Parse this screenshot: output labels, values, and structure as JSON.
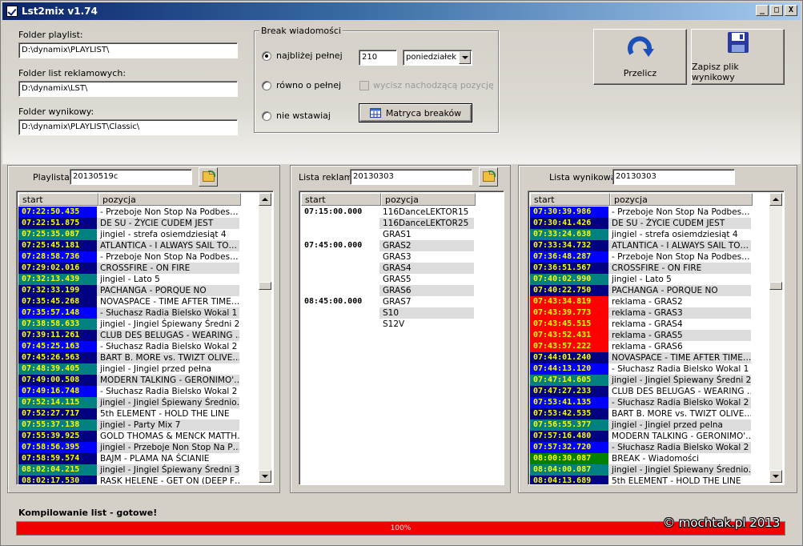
{
  "window": {
    "title": "Lst2mix v1.74",
    "controls": [
      "_",
      "□",
      "X"
    ]
  },
  "folders": {
    "playlist_label": "Folder playlist:",
    "playlist_value": "D:\\dynamix\\PLAYLIST\\",
    "ads_label": "Folder list reklamowych:",
    "ads_value": "D:\\dynamix\\LST\\",
    "output_label": "Folder wynikowy:",
    "output_value": "D:\\dynamix\\PLAYLIST\\Classic\\"
  },
  "break_group": {
    "title": "Break wiadomości",
    "option1": "najbliżej pełnej",
    "option2": "równo o pełnej",
    "option3": "nie wstawiaj",
    "minutes_value": "210",
    "day_value": "poniedziałek",
    "remove_next_label": "wycisz nachodzącą pozycję",
    "matrix_button": "Matryca breaków"
  },
  "actions": {
    "recalc": "Przelicz",
    "save": "Zapisz plik wynikowy"
  },
  "columns": {
    "start": "start",
    "position": "pozycja"
  },
  "playlist": {
    "label": "Playlista:",
    "value": "20130519c",
    "rows": [
      {
        "t": "07:22:50.435",
        "p": " - Przeboje Non Stop Na Podbes…",
        "c": "blue"
      },
      {
        "t": "07:22:51.875",
        "p": "DE SU - ŻYCIE CUDEM JEST",
        "c": "navy"
      },
      {
        "t": "07:25:35.087",
        "p": "jingiel - strefa osiemdziesiąt 4",
        "c": "teal"
      },
      {
        "t": "07:25:45.181",
        "p": "ATLANTICA - I ALWAYS SAIL TO…",
        "c": "navy"
      },
      {
        "t": "07:28:58.736",
        "p": " - Przeboje Non Stop Na Podbes…",
        "c": "blue"
      },
      {
        "t": "07:29:02.016",
        "p": "CROSSFIRE - ON FIRE",
        "c": "navy"
      },
      {
        "t": "07:32:13.439",
        "p": "jingiel - Lato 5",
        "c": "teal"
      },
      {
        "t": "07:32:33.199",
        "p": "PACHANGA - PORQUE NO",
        "c": "navy"
      },
      {
        "t": "07:35:45.268",
        "p": "NOVASPACE - TIME AFTER TIME…",
        "c": "navy"
      },
      {
        "t": "07:35:57.148",
        "p": " - Słuchasz Radia Bielsko Wokal 1",
        "c": "blue"
      },
      {
        "t": "07:38:58.633",
        "p": "jingiel - Jingiel Śpiewany Średni 2",
        "c": "teal"
      },
      {
        "t": "07:39:11.261",
        "p": "CLUB DES BELUGAS - WEARING …",
        "c": "navy"
      },
      {
        "t": "07:45:25.163",
        "p": " - Słuchasz Radia Bielsko Wokal 2",
        "c": "blue"
      },
      {
        "t": "07:45:26.563",
        "p": "BART B. MORE vs. TWIZT OLIVE…",
        "c": "navy"
      },
      {
        "t": "07:48:39.405",
        "p": "jingiel - Jingiel przed pełna",
        "c": "teal"
      },
      {
        "t": "07:49:00.508",
        "p": "MODERN TALKING - GERONIMO'…",
        "c": "navy"
      },
      {
        "t": "07:49:16.748",
        "p": " - Słuchasz Radia Bielsko Wokal 2",
        "c": "blue"
      },
      {
        "t": "07:52:14.115",
        "p": "jingiel - Jingiel Śpiewany Średnio…",
        "c": "teal"
      },
      {
        "t": "07:52:27.717",
        "p": "5th ELEMENT - HOLD THE LINE",
        "c": "navy"
      },
      {
        "t": "07:55:37.138",
        "p": "jingiel - Party Mix 7",
        "c": "teal"
      },
      {
        "t": "07:55:39.925",
        "p": "GOLD THOMAS & MENCK MATTH…",
        "c": "navy"
      },
      {
        "t": "07:58:56.395",
        "p": "jingiel - Przeboje Non Stop Na P…",
        "c": "blue"
      },
      {
        "t": "07:58:59.574",
        "p": "BAJM - PLAMA NA ŚCIANIE",
        "c": "navy"
      },
      {
        "t": "08:02:04.215",
        "p": "jingiel - Jingiel Śpiewany Średni 3",
        "c": "teal"
      },
      {
        "t": "08:02:17.530",
        "p": "RASK HELENE - GET ON (DEEP F…",
        "c": "navy"
      }
    ]
  },
  "ads": {
    "label": "Lista reklam:",
    "value": "20130303",
    "rows": [
      {
        "t": "07:15:00.000",
        "p": "116DanceLEKTOR15"
      },
      {
        "t": "",
        "p": "116DanceLEKTOR25"
      },
      {
        "t": "",
        "p": "GRAS1"
      },
      {
        "t": "07:45:00.000",
        "p": "GRAS2"
      },
      {
        "t": "",
        "p": "GRAS3"
      },
      {
        "t": "",
        "p": "GRAS4"
      },
      {
        "t": "",
        "p": "GRAS5"
      },
      {
        "t": "",
        "p": "GRAS6"
      },
      {
        "t": "08:45:00.000",
        "p": "GRAS7"
      },
      {
        "t": "",
        "p": "S10"
      },
      {
        "t": "",
        "p": "S12V"
      }
    ]
  },
  "output": {
    "label": "Lista wynikowa:",
    "value": "20130303",
    "rows": [
      {
        "t": "07:30:39.986",
        "p": " - Przeboje Non Stop Na Podbes…",
        "c": "blue"
      },
      {
        "t": "07:30:41.426",
        "p": "DE SU - ŻYCIE CUDEM JEST",
        "c": "navy"
      },
      {
        "t": "07:33:24.638",
        "p": "jingiel - strefa osiemdziesiąt 4",
        "c": "teal"
      },
      {
        "t": "07:33:34.732",
        "p": "ATLANTICA - I ALWAYS SAIL TO…",
        "c": "navy"
      },
      {
        "t": "07:36:48.287",
        "p": " - Przeboje Non Stop Na Podbes…",
        "c": "blue"
      },
      {
        "t": "07:36:51.567",
        "p": "CROSSFIRE - ON FIRE",
        "c": "navy"
      },
      {
        "t": "07:40:02.990",
        "p": "jingiel - Lato 5",
        "c": "teal"
      },
      {
        "t": "07:40:22.750",
        "p": "PACHANGA - PORQUE NO",
        "c": "navy"
      },
      {
        "t": "07:43:34.819",
        "p": "reklama - GRAS2",
        "c": "red"
      },
      {
        "t": "07:43:39.773",
        "p": "reklama - GRAS3",
        "c": "red"
      },
      {
        "t": "07:43:45.515",
        "p": "reklama - GRAS4",
        "c": "red"
      },
      {
        "t": "07:43:52.431",
        "p": "reklama - GRAS5",
        "c": "red"
      },
      {
        "t": "07:43:57.222",
        "p": "reklama - GRAS6",
        "c": "red"
      },
      {
        "t": "07:44:01.240",
        "p": "NOVASPACE - TIME AFTER TIME…",
        "c": "navy"
      },
      {
        "t": "07:44:13.120",
        "p": " - Słuchasz Radia Bielsko Wokal 1",
        "c": "blue"
      },
      {
        "t": "07:47:14.605",
        "p": "jingiel - Jingiel Śpiewany Średni 2",
        "c": "teal"
      },
      {
        "t": "07:47:27.233",
        "p": "CLUB DES BELUGAS - WEARING …",
        "c": "navy"
      },
      {
        "t": "07:53:41.135",
        "p": " - Słuchasz Radia Bielsko Wokal 2",
        "c": "blue"
      },
      {
        "t": "07:53:42.535",
        "p": "BART B. MORE vs. TWIZT OLIVE…",
        "c": "navy"
      },
      {
        "t": "07:56:55.377",
        "p": "jingiel - Jingiel przed pelna",
        "c": "teal"
      },
      {
        "t": "07:57:16.480",
        "p": "MODERN TALKING - GERONIMO'…",
        "c": "navy"
      },
      {
        "t": "07:57:32.720",
        "p": " - Słuchasz Radia Bielsko Wokal 2",
        "c": "blue"
      },
      {
        "t": "08:00:30.087",
        "p": "BREAK - Wiadomości",
        "c": "green"
      },
      {
        "t": "08:04:00.087",
        "p": "jingiel - Jingiel Śpiewany Średnio…",
        "c": "teal"
      },
      {
        "t": "08:04:13.689",
        "p": "5th ELEMENT - HOLD THE LINE",
        "c": "navy"
      }
    ]
  },
  "status": {
    "text": "Kompilowanie list - gotowe!",
    "progress_label": "100%",
    "progress": 1.0
  },
  "copyright": "© mochtak.pl 2013",
  "colors": {
    "blue": "#0000ff",
    "navy": "#000080",
    "teal": "#008080",
    "red": "#ff0000",
    "green": "#008000",
    "time_text": "#ffff00",
    "red_time_text": "#ffff00",
    "stripe": "#dcdcdc"
  }
}
